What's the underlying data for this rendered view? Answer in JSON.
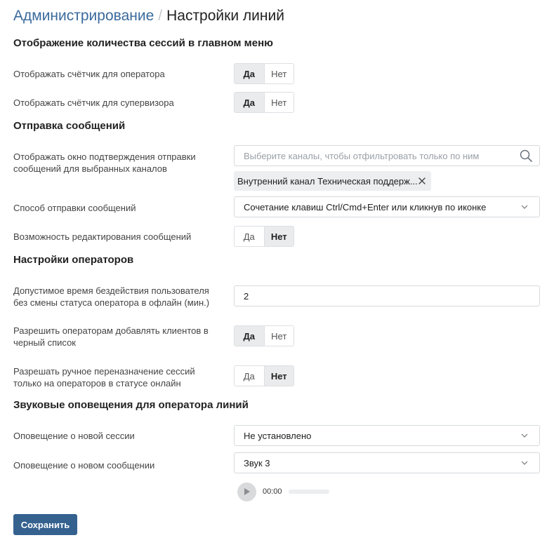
{
  "breadcrumb": {
    "parent": "Администрирование",
    "separator": "/",
    "current": "Настройки линий"
  },
  "sections": {
    "sessions_count": "Отображение количества сессий в главном меню",
    "messages": "Отправка сообщений",
    "operators": "Настройки операторов",
    "sound": "Звуковые оповещения для оператора линий"
  },
  "settings": {
    "counter_operator": {
      "label": "Отображать счётчик для оператора",
      "yes": "Да",
      "no": "Нет",
      "selected": "yes"
    },
    "counter_supervisor": {
      "label": "Отображать счётчик для супервизора",
      "yes": "Да",
      "no": "Нет",
      "selected": "yes"
    },
    "confirm_window": {
      "label": "Отображать окно подтверждения отправки сообщений для выбранных каналов",
      "placeholder": "Выберите каналы, чтобы отфильтровать только по ним",
      "tag": "Внутренний канал Техническая поддерж..."
    },
    "send_method": {
      "label": "Способ отправки сообщений",
      "value": "Сочетание клавиш Ctrl/Cmd+Enter или кликнув по иконке"
    },
    "edit_messages": {
      "label": "Возможность редактирования сообщений",
      "yes": "Да",
      "no": "Нет",
      "selected": "no"
    },
    "idle_time": {
      "label": "Допустимое время бездействия пользователя без смены статуса оператора в офлайн (мин.)",
      "value": "2"
    },
    "blacklist": {
      "label": "Разрешить операторам добавлять клиентов в черный список",
      "yes": "Да",
      "no": "Нет",
      "selected": "yes"
    },
    "manual_reassign": {
      "label": "Разрешать ручное переназначение сессий только на операторов в статусе онлайн",
      "yes": "Да",
      "no": "Нет",
      "selected": "no"
    },
    "new_session_sound": {
      "label": "Оповещение о новой сессии",
      "value": "Не установлено"
    },
    "new_message_sound": {
      "label": "Оповещение о новом сообщении",
      "value": "Звук 3"
    }
  },
  "player": {
    "time": "00:00",
    "progress": 0
  },
  "save_label": "Сохранить",
  "colors": {
    "accent": "#35618f",
    "link": "#3a6a9c",
    "toggle_active": "#eaebec"
  },
  "icons": {
    "search": "search-icon",
    "chevron": "chevron-down-icon",
    "close": "close-icon",
    "play": "play-icon"
  }
}
